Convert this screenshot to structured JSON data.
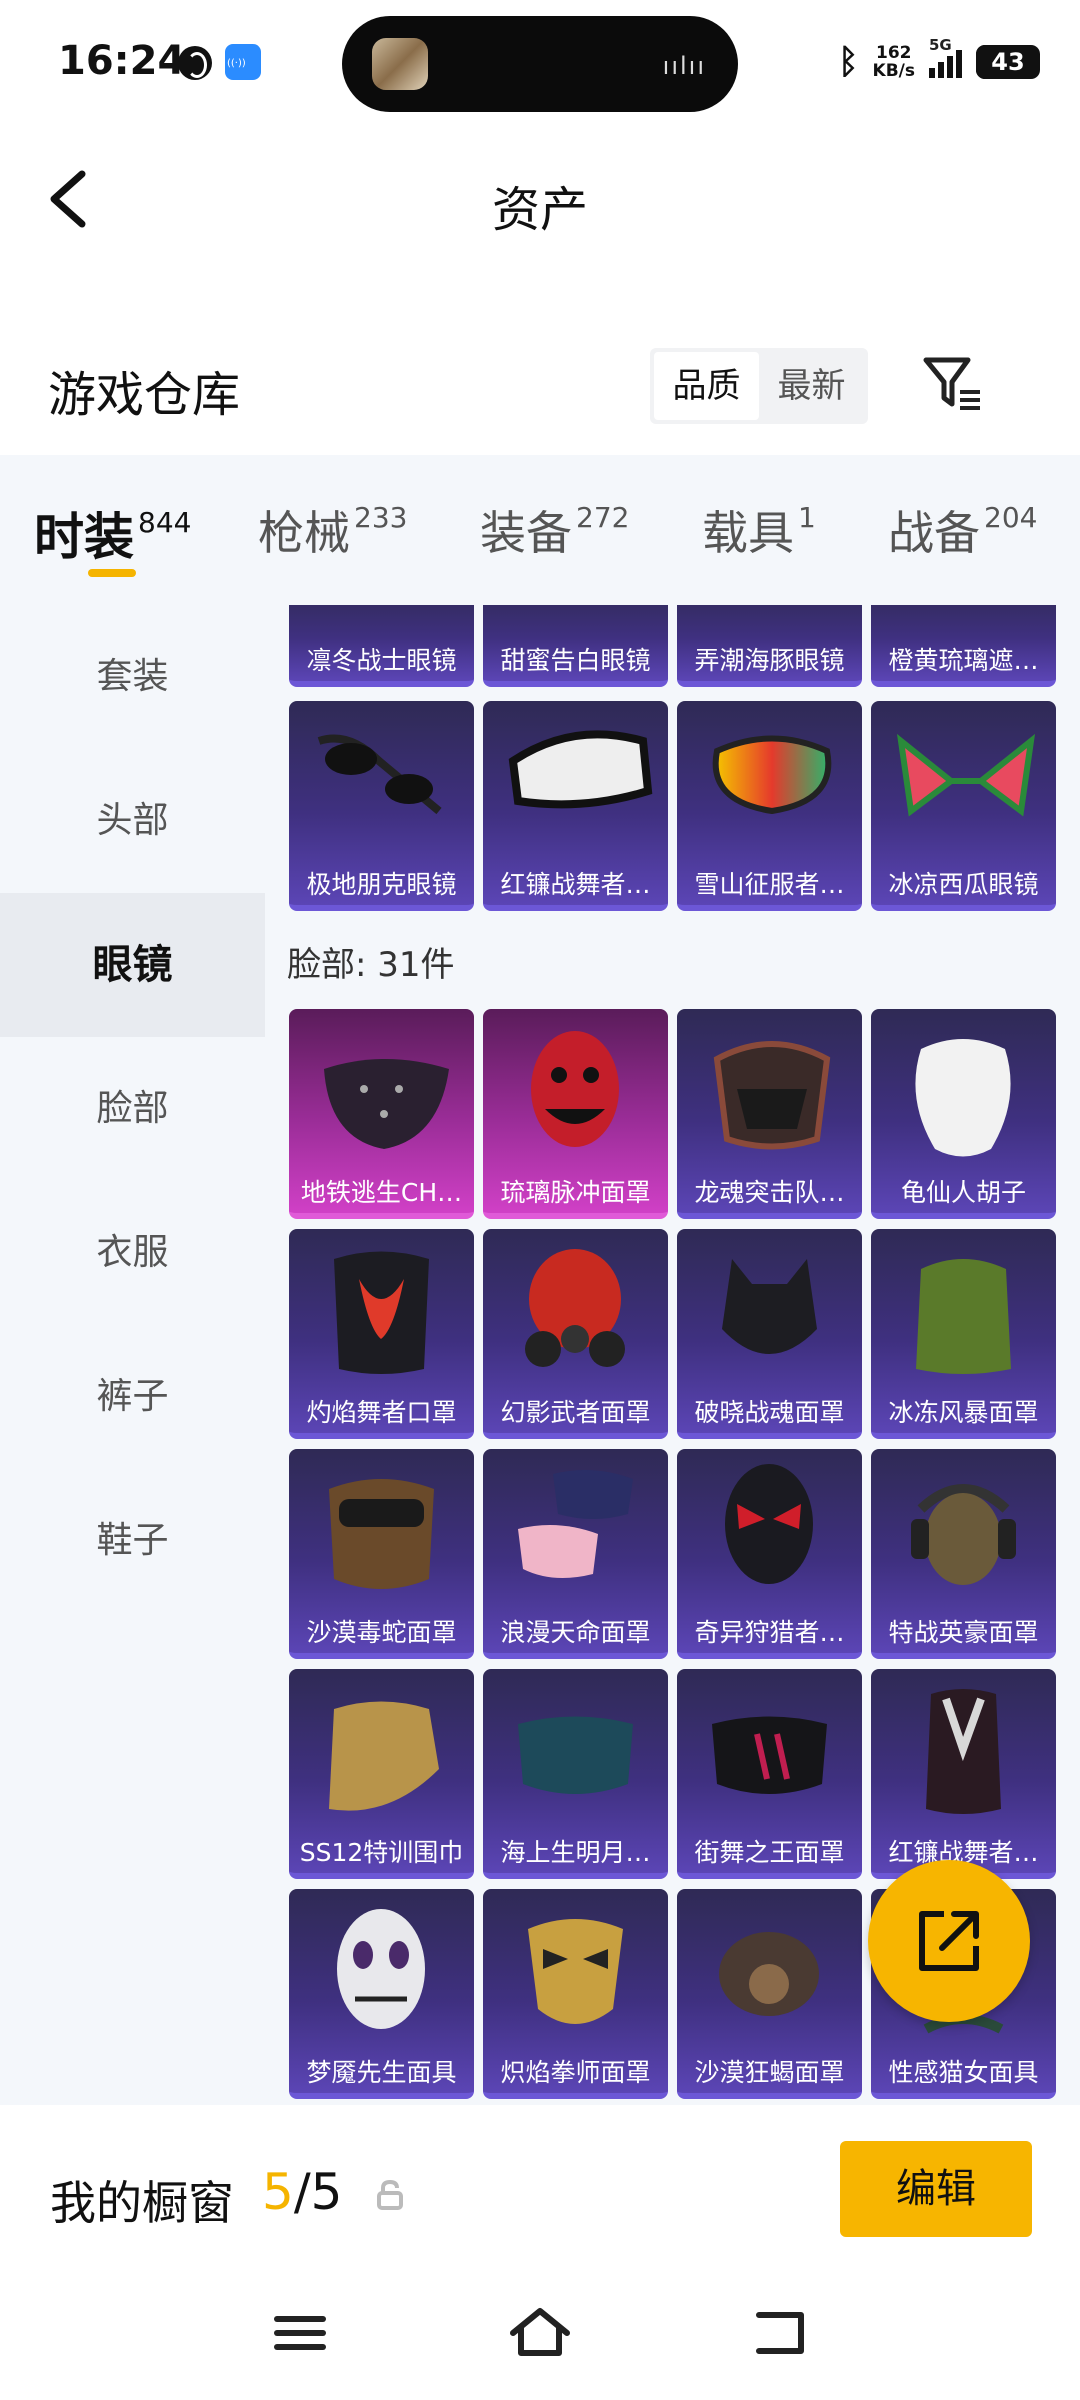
{
  "status_bar": {
    "time": "16:24",
    "net_speed": "162",
    "net_unit": "KB/s",
    "signal_label": "5G",
    "battery": "43",
    "icons": [
      "globe-icon",
      "app-notify-icon",
      "bluetooth-icon",
      "signal-icon",
      "battery-icon"
    ]
  },
  "header": {
    "title": "资产"
  },
  "warehouse": {
    "title": "游戏仓库",
    "sort_options": [
      "品质",
      "最新"
    ],
    "sort_active": "品质"
  },
  "tabs": [
    {
      "label": "时装",
      "count": "844",
      "active": true
    },
    {
      "label": "枪械",
      "count": "233",
      "active": false
    },
    {
      "label": "装备",
      "count": "272",
      "active": false
    },
    {
      "label": "载具",
      "count": "1",
      "active": false
    },
    {
      "label": "战备",
      "count": "204",
      "active": false
    }
  ],
  "sidebar": {
    "items": [
      "套装",
      "头部",
      "眼镜",
      "脸部",
      "衣服",
      "裤子",
      "鞋子"
    ],
    "active": "眼镜"
  },
  "glasses_row_top": [
    "凛冬战士眼镜",
    "甜蜜告白眼镜",
    "弄潮海豚眼镜",
    "橙黄琉璃遮…"
  ],
  "glasses_row": [
    "极地朋克眼镜",
    "红镰战舞者…",
    "雪山征服者…",
    "冰凉西瓜眼镜"
  ],
  "face_section": {
    "label": "脸部: 31件",
    "rows": [
      [
        "地铁逃生CH…",
        "琉璃脉冲面罩",
        "龙魂突击队…",
        "龟仙人胡子"
      ],
      [
        "灼焰舞者口罩",
        "幻影武者面罩",
        "破晓战魂面罩",
        "冰冻风暴面罩"
      ],
      [
        "沙漠毒蛇面罩",
        "浪漫天命面罩",
        "奇异狩猎者…",
        "特战英豪面罩"
      ],
      [
        "SS12特训围巾",
        "海上生明月…",
        "街舞之王面罩",
        "红镰战舞者…"
      ],
      [
        "梦魇先生面具",
        "炽焰拳师面罩",
        "沙漠狂蝎面罩",
        "性感猫女面具"
      ]
    ]
  },
  "bottom": {
    "label": "我的橱窗",
    "count_current": "5",
    "count_sep": "/",
    "count_total": "5",
    "edit_label": "编辑"
  },
  "colors": {
    "accent": "#f7b500",
    "card_purple": "#3f3080",
    "card_pink": "#9b2d98",
    "panel_bg": "#f4f7fb"
  }
}
